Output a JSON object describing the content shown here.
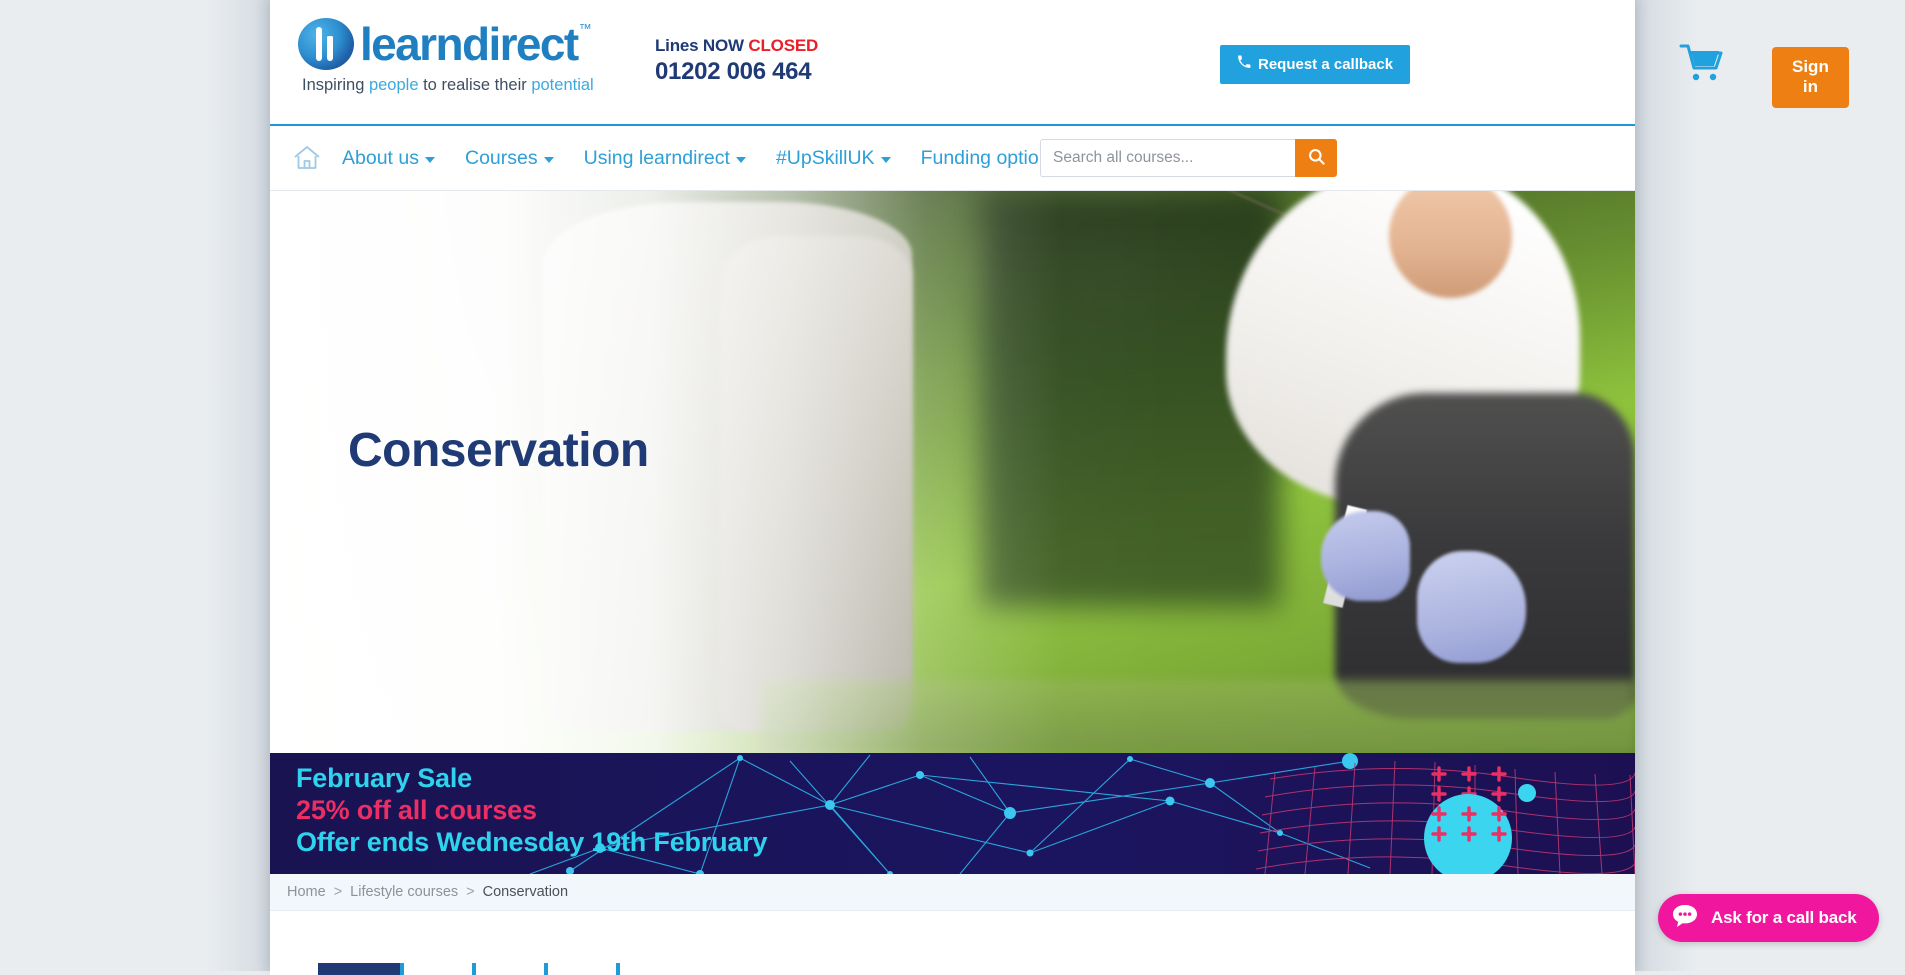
{
  "header": {
    "logo_text": "learndirect",
    "logo_tm": "™",
    "tagline_1": "Inspiring ",
    "tagline_people": "people",
    "tagline_2": " to realise their ",
    "tagline_potential": "potential",
    "lines_label": "Lines NOW ",
    "lines_status": "CLOSED",
    "phone": "01202 006 464",
    "callback_label": "Request a callback",
    "callback_icon": "phone-icon",
    "cart_icon": "shopping-cart-icon",
    "signin_label": "Sign in"
  },
  "nav": {
    "home_icon": "home-icon",
    "items": [
      {
        "label": "About us",
        "has_dropdown": true
      },
      {
        "label": "Courses",
        "has_dropdown": true
      },
      {
        "label": "Using learndirect",
        "has_dropdown": true
      },
      {
        "label": "#UpSkillUK",
        "has_dropdown": true
      },
      {
        "label": "Funding options",
        "has_dropdown": true
      }
    ],
    "search_placeholder": "Search all courses...",
    "search_value": "",
    "search_icon": "search-icon"
  },
  "hero": {
    "title": "Conservation",
    "image_alt": "conservation-field-worker-photo"
  },
  "sale_banner": {
    "line1": "February Sale",
    "line2": "25% off all courses",
    "line3": "Offer ends Wednesday 19th February"
  },
  "breadcrumb": {
    "items": [
      "Home",
      "Lifestyle courses",
      "Conservation"
    ],
    "separator": ">"
  },
  "chat": {
    "label": "Ask for a call back",
    "icon": "chat-bubble-icon"
  },
  "colors": {
    "brand_blue": "#2e9fd8",
    "brand_orange": "#ee7f12",
    "navy": "#1f3a75",
    "red": "#e8202a",
    "sale_cyan": "#2fd3ee",
    "sale_pink": "#ec2e64",
    "sale_bg": "#1b1559",
    "chat_magenta": "#f0179e"
  }
}
